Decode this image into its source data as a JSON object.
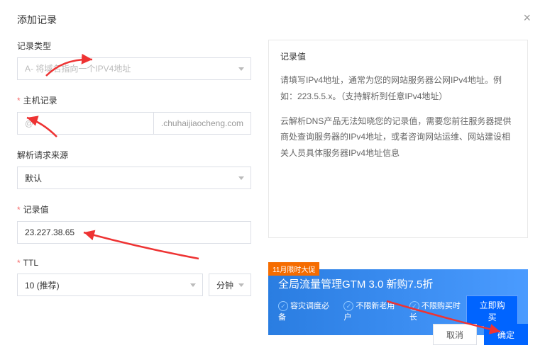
{
  "dialog": {
    "title": "添加记录"
  },
  "form": {
    "record_type": {
      "label": "记录类型",
      "placeholder": "A- 将域名指向一个IPV4地址"
    },
    "host_record": {
      "label": "主机记录",
      "placeholder": "@",
      "suffix": ".chuhaijiaocheng.com"
    },
    "request_source": {
      "label": "解析请求来源",
      "value": "默认"
    },
    "record_value": {
      "label": "记录值",
      "value": "23.227.38.65"
    },
    "ttl": {
      "label": "TTL",
      "value": "10 (推荐)",
      "unit": "分钟"
    }
  },
  "help": {
    "title": "记录值",
    "p1": "请填写IPv4地址，通常为您的网站服务器公网IPv4地址。例如：223.5.5.x。（支持解析到任意IPv4地址）",
    "p2": "云解析DNS产品无法知晓您的记录值，需要您前往服务器提供商处查询服务器的IPv4地址，或者咨询网站运维、网站建设相关人员具体服务器IPv4地址信息"
  },
  "promo": {
    "tag": "11月限时大促",
    "title": "全局流量管理GTM 3.0 新购7.5折",
    "feat1": "容灾调度必备",
    "feat2": "不限新老用户",
    "feat3": "不限购买时长",
    "cta": "立即购买"
  },
  "footer": {
    "cancel": "取消",
    "ok": "确定"
  }
}
